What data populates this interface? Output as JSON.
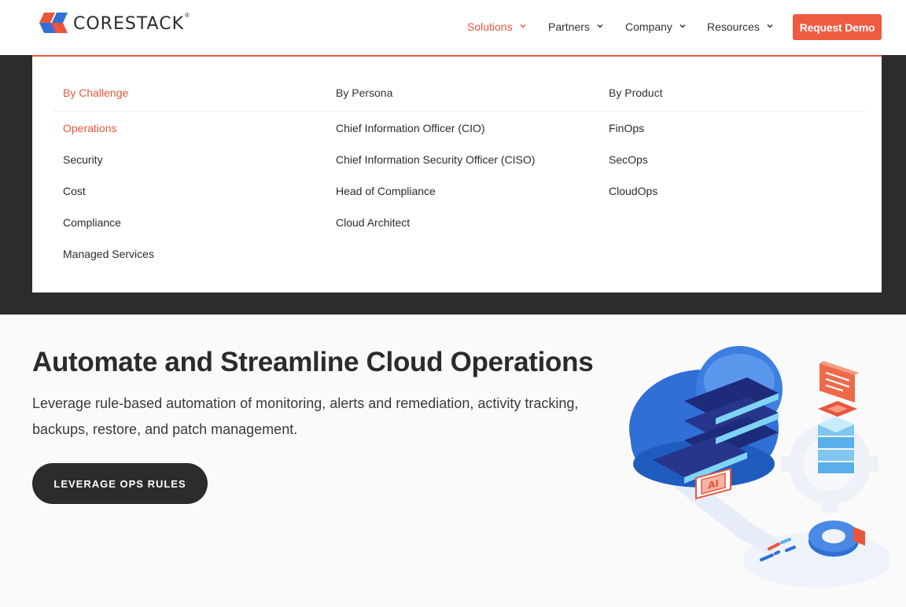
{
  "brand": {
    "name": "CORESTACK",
    "reg": "®"
  },
  "nav": {
    "items": [
      {
        "label": "Solutions",
        "active": true
      },
      {
        "label": "Partners",
        "active": false
      },
      {
        "label": "Company",
        "active": false
      },
      {
        "label": "Resources",
        "active": false
      }
    ],
    "cta": "Request Demo"
  },
  "mega_menu": {
    "columns": [
      {
        "heading": "By Challenge",
        "links": [
          "Operations",
          "Security",
          "Cost",
          "Compliance",
          "Managed Services"
        ]
      },
      {
        "heading": "By Persona",
        "links": [
          "Chief Information Officer (CIO)",
          "Chief Information Security Officer (CISO)",
          "Head of Compliance",
          "Cloud Architect"
        ]
      },
      {
        "heading": "By Product",
        "links": [
          "FinOps",
          "SecOps",
          "CloudOps"
        ]
      }
    ]
  },
  "hero": {
    "title": "Automate and Streamline Cloud Operations",
    "description": "Leverage rule-based automation of monitoring, alerts and remediation, activity tracking, backups, restore, and patch management.",
    "button": "LEVERAGE OPS RULES",
    "illustration_badge": "AI"
  },
  "colors": {
    "accent": "#e8563b",
    "cta": "#ef5a41",
    "dark": "#2d2c2a"
  }
}
